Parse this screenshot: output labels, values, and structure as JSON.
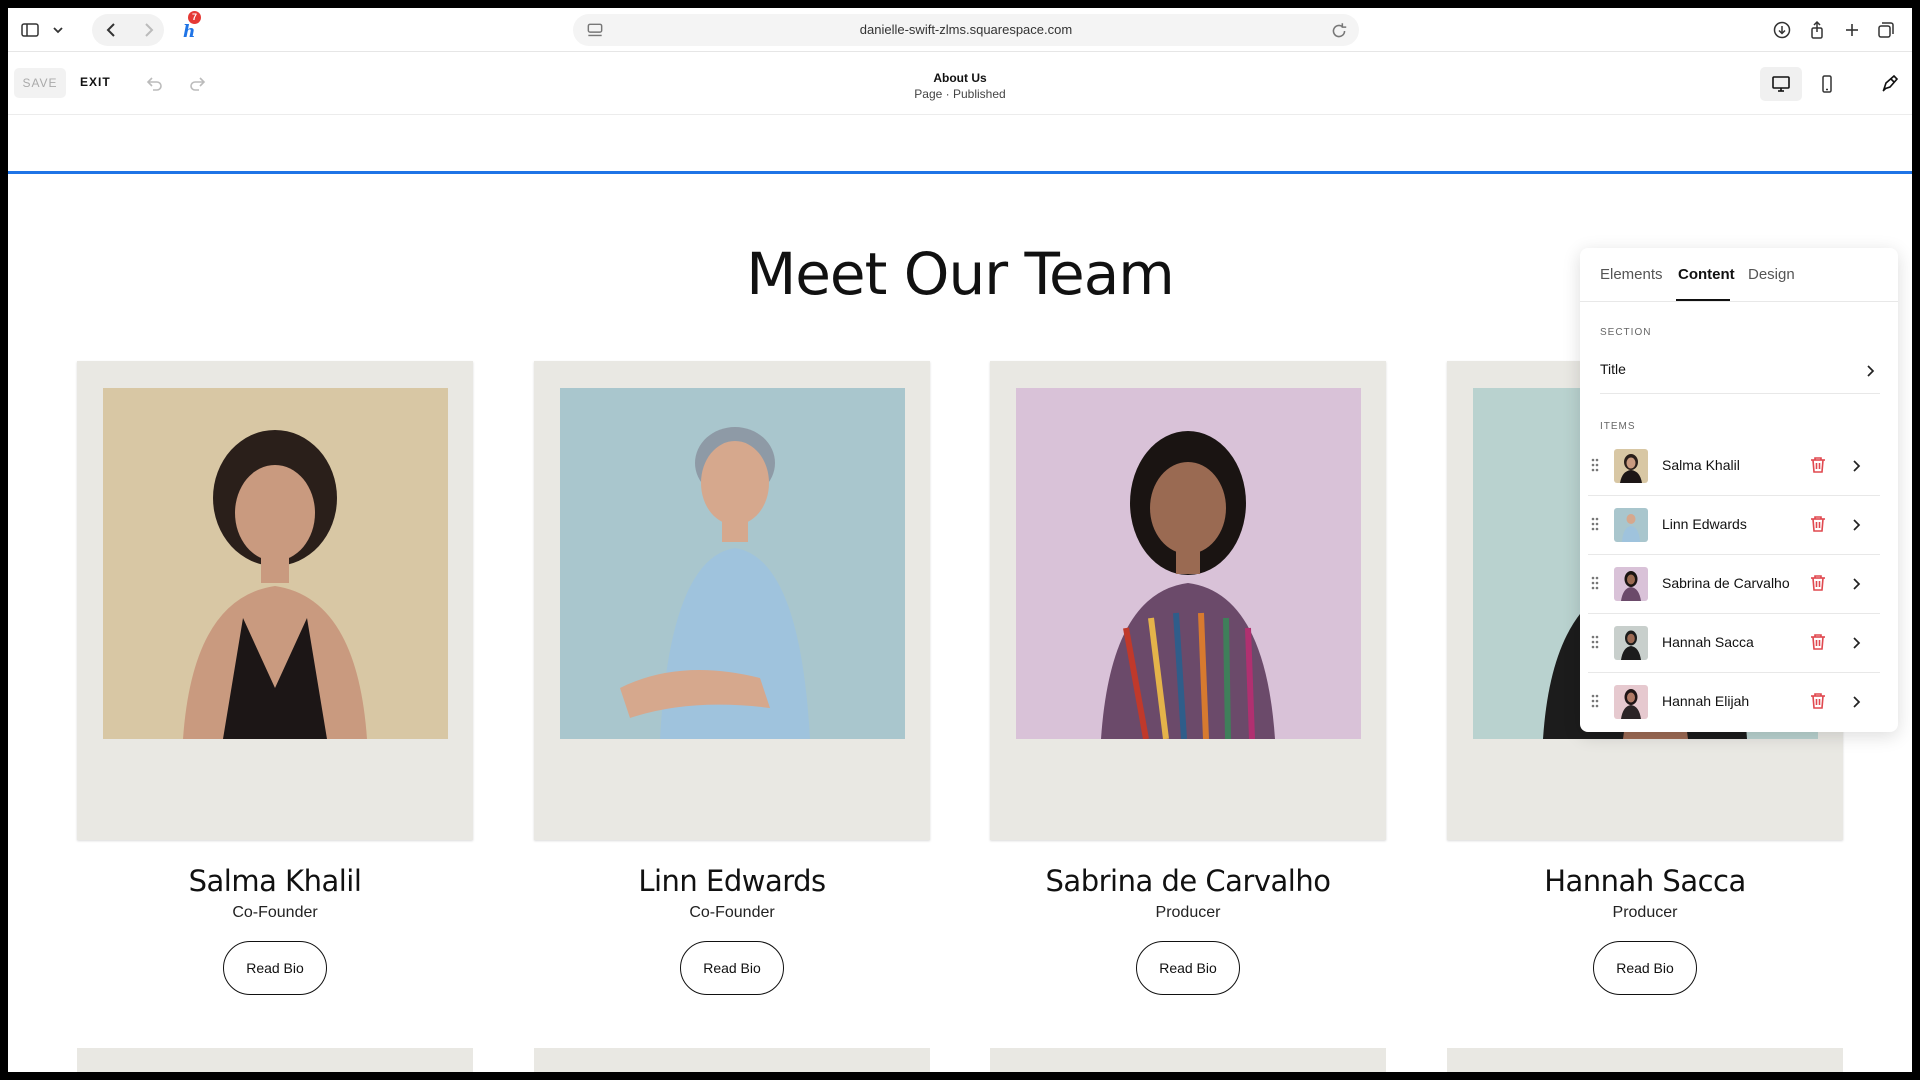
{
  "browser": {
    "url": "danielle-swift-zlms.squarespace.com",
    "extension_badge": "7"
  },
  "toolbar": {
    "save_label": "SAVE",
    "exit_label": "EXIT",
    "page_title": "About Us",
    "page_status": "Page · Published"
  },
  "section": {
    "title": "Meet Our Team"
  },
  "team": [
    {
      "name": "Salma Khalil",
      "role": "Co-Founder",
      "button": "Read Bio"
    },
    {
      "name": "Linn Edwards",
      "role": "Co-Founder",
      "button": "Read Bio"
    },
    {
      "name": "Sabrina de Carvalho",
      "role": "Producer",
      "button": "Read Bio"
    },
    {
      "name": "Hannah Sacca",
      "role": "Producer",
      "button": "Read Bio"
    }
  ],
  "panel": {
    "tabs": [
      "Elements",
      "Content",
      "Design"
    ],
    "active_tab": "Content",
    "section_label": "SECTION",
    "section_row": "Title",
    "items_label": "ITEMS",
    "items": [
      "Salma Khalil",
      "Linn Edwards",
      "Sabrina de Carvalho",
      "Hannah Sacca",
      "Hannah Elijah"
    ]
  },
  "colors": {
    "accent_blue": "#1f74e6",
    "delete_red": "#e0484f",
    "polaroid_frame": "#e9e8e3"
  },
  "icons": {
    "chrome": [
      "sidebar-icon",
      "chevron-down-icon",
      "back-icon",
      "forward-icon",
      "honey-extension-icon",
      "page-settings-icon",
      "reload-icon",
      "download-icon",
      "share-icon",
      "new-tab-icon",
      "tabs-overview-icon"
    ],
    "toolbar": [
      "undo-icon",
      "redo-icon",
      "desktop-view-icon",
      "mobile-view-icon",
      "site-styles-icon"
    ],
    "panel": [
      "drag-handle-icon",
      "trash-icon",
      "chevron-right-icon"
    ]
  }
}
